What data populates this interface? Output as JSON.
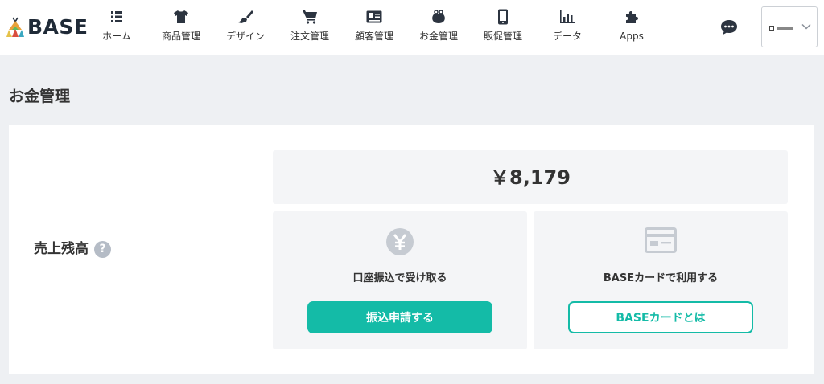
{
  "brand": {
    "name": "BASE"
  },
  "nav": [
    {
      "label": "ホーム",
      "icon": "list-icon"
    },
    {
      "label": "商品管理",
      "icon": "tshirt-icon"
    },
    {
      "label": "デザイン",
      "icon": "paintbrush-icon"
    },
    {
      "label": "注文管理",
      "icon": "cart-icon"
    },
    {
      "label": "顧客管理",
      "icon": "id-card-icon"
    },
    {
      "label": "お金管理",
      "icon": "coin-purse-icon"
    },
    {
      "label": "販促管理",
      "icon": "smartphone-icon"
    },
    {
      "label": "データ",
      "icon": "bar-chart-icon"
    },
    {
      "label": "Apps",
      "icon": "puzzle-icon"
    }
  ],
  "header_actions": {
    "chat_icon": "chat-bubble-icon",
    "shop_select_icon": "chevron-down-icon"
  },
  "page": {
    "title": "お金管理"
  },
  "sales": {
    "label": "売上残高",
    "help": "?",
    "balance": "￥8,179"
  },
  "options": {
    "bank": {
      "icon": "yen-icon",
      "title": "口座振込で受け取る",
      "button": "振込申請する"
    },
    "card": {
      "icon": "credit-card-icon",
      "title": "BASEカードで利用する",
      "button": "BASEカードとは"
    }
  },
  "colors": {
    "accent": "#14bba7",
    "text": "#333333",
    "header_bg": "#ffffff",
    "page_bg": "#eef0f3",
    "icon_gray": "#c6cbd2"
  }
}
